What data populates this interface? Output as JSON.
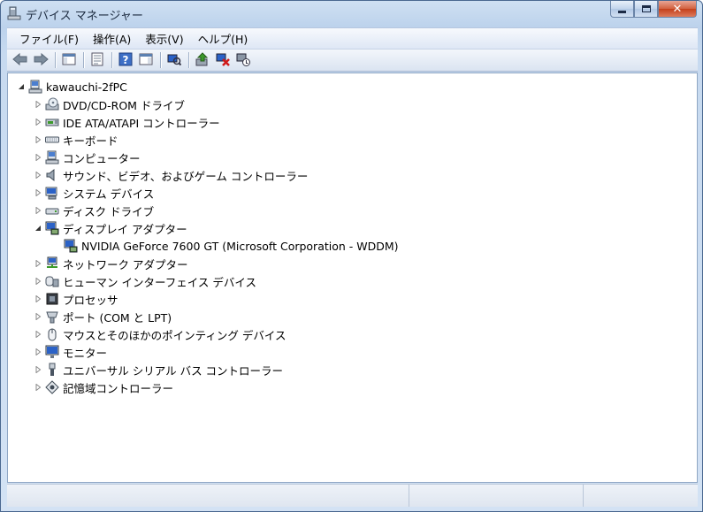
{
  "window": {
    "title": "デバイス マネージャー",
    "caption_min": "—",
    "caption_max": "▢",
    "caption_close": "✕"
  },
  "menu": [
    {
      "label": "ファイル(F)",
      "name": "menu-file"
    },
    {
      "label": "操作(A)",
      "name": "menu-action"
    },
    {
      "label": "表示(V)",
      "name": "menu-view"
    },
    {
      "label": "ヘルプ(H)",
      "name": "menu-help"
    }
  ],
  "toolbar": [
    {
      "name": "back-button",
      "icon": "back-arrow-icon"
    },
    {
      "name": "forward-button",
      "icon": "forward-arrow-icon"
    },
    {
      "sep": true
    },
    {
      "name": "show-hide-console-tree-button",
      "icon": "console-tree-icon"
    },
    {
      "sep": true
    },
    {
      "name": "properties-button",
      "icon": "properties-icon"
    },
    {
      "sep": true
    },
    {
      "name": "help-button",
      "icon": "help-icon"
    },
    {
      "name": "show-action-pane-button",
      "icon": "action-pane-icon"
    },
    {
      "sep": true
    },
    {
      "name": "scan-hardware-changes-button",
      "icon": "scan-hardware-icon"
    },
    {
      "sep": true
    },
    {
      "name": "update-driver-button",
      "icon": "update-driver-icon"
    },
    {
      "name": "uninstall-button",
      "icon": "uninstall-icon"
    },
    {
      "name": "disable-button",
      "icon": "disable-device-icon"
    }
  ],
  "tree": {
    "root": {
      "label": "kawauchi-2fPC",
      "icon": "computer-icon",
      "expanded": true
    },
    "items": [
      {
        "label": "DVD/CD-ROM ドライブ",
        "icon": "dvd-drive-icon",
        "expanded": false
      },
      {
        "label": "IDE ATA/ATAPI コントローラー",
        "icon": "ide-controller-icon",
        "expanded": false
      },
      {
        "label": "キーボード",
        "icon": "keyboard-icon",
        "expanded": false
      },
      {
        "label": "コンピューター",
        "icon": "computer-icon",
        "expanded": false
      },
      {
        "label": "サウンド、ビデオ、およびゲーム コントローラー",
        "icon": "speaker-icon",
        "expanded": false
      },
      {
        "label": "システム デバイス",
        "icon": "system-device-icon",
        "expanded": false
      },
      {
        "label": "ディスク ドライブ",
        "icon": "disk-drive-icon",
        "expanded": false
      },
      {
        "label": "ディスプレイ アダプター",
        "icon": "display-adapter-icon",
        "expanded": true,
        "children": [
          {
            "label": "NVIDIA GeForce 7600 GT (Microsoft Corporation - WDDM)",
            "icon": "display-adapter-icon"
          }
        ]
      },
      {
        "label": "ネットワーク アダプター",
        "icon": "network-adapter-icon",
        "expanded": false
      },
      {
        "label": "ヒューマン インターフェイス デバイス",
        "icon": "hid-icon",
        "expanded": false
      },
      {
        "label": "プロセッサ",
        "icon": "processor-icon",
        "expanded": false
      },
      {
        "label": "ポート (COM と LPT)",
        "icon": "port-icon",
        "expanded": false
      },
      {
        "label": "マウスとそのほかのポインティング デバイス",
        "icon": "mouse-icon",
        "expanded": false
      },
      {
        "label": "モニター",
        "icon": "monitor-icon",
        "expanded": false
      },
      {
        "label": "ユニバーサル シリアル バス コントローラー",
        "icon": "usb-icon",
        "expanded": false
      },
      {
        "label": "記憶域コントローラー",
        "icon": "storage-controller-icon",
        "expanded": false
      }
    ]
  },
  "colors": {
    "accent": "#3a6ea5",
    "monitor_screen": "#2b62c7",
    "update_green": "#3c9a2b",
    "uninstall_red": "#d01818"
  }
}
